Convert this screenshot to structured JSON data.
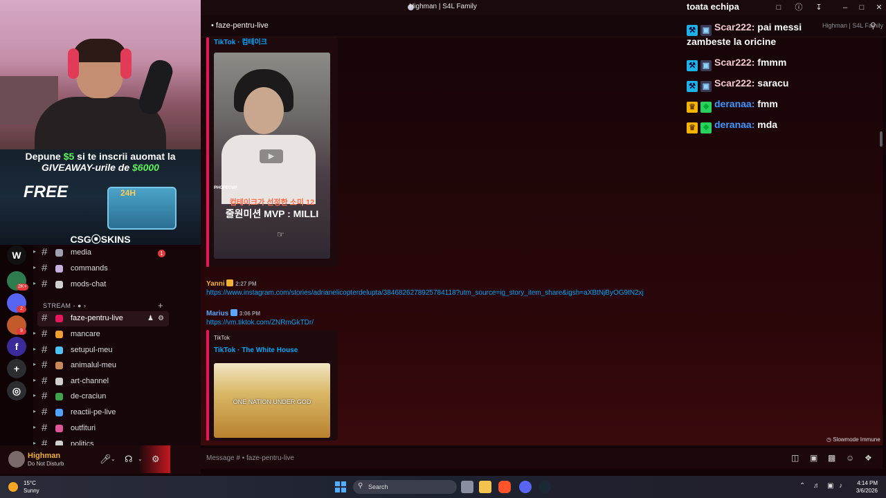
{
  "window": {
    "title": "Highman | S4L Family"
  },
  "topbar": {
    "channel": "faze-pentru-live",
    "right_label": "Highman | S4L Family",
    "search_icon": "search-icon"
  },
  "stream_overlay": {
    "ad_line1_a": "Depune ",
    "ad_line1_amount": "$5",
    "ad_line1_b": " si te inscrii auomat la",
    "ad_line2_a": "GIVEAWAY-urile de ",
    "ad_line2_amount": "$6000",
    "ad_free": "FREE",
    "ad_case_label": "24H",
    "ad_brand": "CSG⦿SKINS"
  },
  "chat": {
    "header": "toata echipa",
    "lines": [
      {
        "user": "Scar222:",
        "text": " pai messi",
        "badges": [
          "mod",
          "bot"
        ]
      },
      {
        "user": "",
        "text": "zambeste la oricine",
        "badges": []
      },
      {
        "user": "Scar222:",
        "text": " fmmm",
        "badges": [
          "mod",
          "bot"
        ]
      },
      {
        "user": "Scar222:",
        "text": " saracu",
        "badges": [
          "mod",
          "bot"
        ]
      },
      {
        "user": "deranaa:",
        "text": " fmm",
        "badges": [
          "crown",
          "gift"
        ]
      },
      {
        "user": "deranaa:",
        "text": " mda",
        "badges": [
          "crown",
          "gift"
        ]
      }
    ]
  },
  "channels": {
    "items": [
      {
        "label": "media",
        "emoji_color": "#a0a0b0",
        "unread": "1"
      },
      {
        "label": "commands",
        "emoji_color": "#c7b0e0"
      },
      {
        "label": "mods-chat",
        "emoji_color": "#d0d0d0"
      },
      {
        "label": "faze-pentru-live",
        "emoji_color": "#e8175d",
        "active": true
      },
      {
        "label": "mancare",
        "emoji_color": "#f0a030"
      },
      {
        "label": "setupul-meu",
        "emoji_color": "#4fc3f7"
      },
      {
        "label": "animalul-meu",
        "emoji_color": "#c98a5a"
      },
      {
        "label": "art-channel",
        "emoji_color": "#d0d0d0"
      },
      {
        "label": "de-craciun",
        "emoji_color": "#3fa34d"
      },
      {
        "label": "reactii-pe-live",
        "emoji_color": "#4fa3ff"
      },
      {
        "label": "outfituri",
        "emoji_color": "#e0559a"
      },
      {
        "label": "politics",
        "emoji_color": "#d0d0d0"
      }
    ],
    "category_stream": "STREAM - ● ›"
  },
  "servers": [
    {
      "label": "W",
      "color": "#111"
    },
    {
      "label": "",
      "color": "#2f7d4f",
      "badge": "2K+"
    },
    {
      "label": "",
      "color": "#5865f2",
      "badge": "2"
    },
    {
      "label": "",
      "color": "#c35a2b",
      "badge": "9"
    },
    {
      "label": "f",
      "color": "#3b2b9a"
    },
    {
      "label": "+",
      "color": "#2b2d31"
    },
    {
      "label": "◎",
      "color": "#2b2d31"
    }
  ],
  "user_panel": {
    "name": "Highman",
    "status": "Do Not Disturb"
  },
  "messages": {
    "embed1_provider": "TikTok · 컴테이크",
    "embed1_overlay_top": "컴테이크가 선정한 소미 12",
    "embed1_overlay_bottom": "줄원미션 MVP : MILLI",
    "embed1_brand": "PHOPECUP",
    "msg1": {
      "author": "Yanni",
      "time": "2:27 PM",
      "color": "#f0b232",
      "link": "https://www.instagram.com/stories/adrianelicopterdelupta/3846826278925784118?utm_source=ig_story_item_share&igsh=aXBtNjByOG9tN2xj"
    },
    "msg2": {
      "author": "Marius",
      "time": "3:06 PM",
      "color": "#5aa7ff",
      "link": "https://vm.tiktok.com/ZNRmGkTDr/"
    },
    "embed2_site": "TikTok",
    "embed2_title": "TikTok · The White House",
    "embed2_overlay": "ONE NATION UNDER GOD",
    "slowmode": "Slowmode Immune"
  },
  "composer": {
    "placeholder": "Message # • faze-pentru-live"
  },
  "taskbar": {
    "temp": "15°C",
    "condition": "Sunny",
    "search": "Search",
    "time": "4:14 PM",
    "date": "3/6/2026"
  }
}
